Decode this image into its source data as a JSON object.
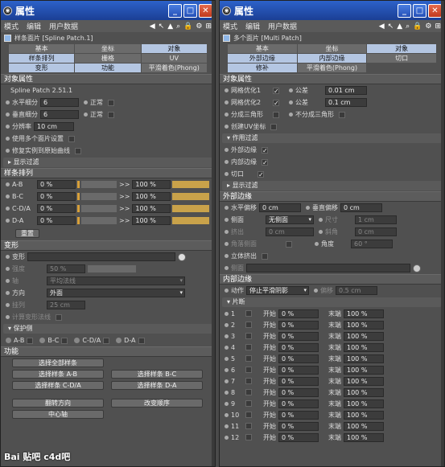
{
  "left": {
    "title": "属性",
    "menu": [
      "模式",
      "编辑",
      "用户数据"
    ],
    "object_name": "样条面片 [Spline Patch.1]",
    "tabs": [
      [
        "基本",
        "坐标",
        "对象"
      ],
      [
        "样条排列",
        "栅格",
        "UV"
      ],
      [
        "变形",
        "功能",
        "平滑着色(Phong)"
      ]
    ],
    "active_tab": "对象",
    "obj_props": {
      "header": "对象属性",
      "version": "Spline Patch 2.51.1",
      "h_sub_label": "水平细分",
      "h_sub_value": "6",
      "h_normal_label": "正常",
      "v_sub_label": "垂直细分",
      "v_sub_value": "6",
      "v_normal_label": "正常",
      "res_label": "分辨率",
      "res_value": "10 cm",
      "multi_patch": "使用多个面片设置",
      "fix_inst": "修复实例到原始曲线",
      "show_filter": "显示过滤"
    },
    "spline_layout": {
      "header": "样条排列",
      "rows": [
        {
          "label": "A-B",
          "start": "0 %",
          "end": "100 %"
        },
        {
          "label": "B-C",
          "start": "0 %",
          "end": "100 %"
        },
        {
          "label": "C-D/A",
          "start": "0 %",
          "end": "100 %"
        },
        {
          "label": "D-A",
          "start": "0 %",
          "end": "100 %"
        }
      ],
      "reset": "重置"
    },
    "deform": {
      "header": "变形",
      "deform_label": "变形",
      "strength_label": "强度",
      "strength_value": "50 %",
      "axis_label": "轴",
      "axis_value": "平均法线",
      "dir_label": "方向",
      "dir_value": "外面",
      "offset_label": "挂列",
      "offset_value": "25 cm",
      "calc_label": "计算变形法线",
      "protect": "保护侧",
      "protect_items": [
        "A-B",
        "B-C",
        "C-D/A",
        "D-A"
      ]
    },
    "funcs": {
      "header": "功能",
      "select_all": "选择全部样条",
      "sel_ab": "选择样条 A-B",
      "sel_bc": "选择样条 B-C",
      "sel_cda": "选择样条 C-D/A",
      "sel_da": "选择样条 D-A",
      "flip": "翻转方向",
      "reorder": "改变顺序",
      "center": "中心轴"
    },
    "watermark": "Bai 贴吧 c4d吧"
  },
  "right": {
    "title": "属性",
    "menu": [
      "模式",
      "编辑",
      "用户数据"
    ],
    "object_name": "多个面片 [Multi Patch]",
    "tabs": [
      [
        "基本",
        "坐标",
        "对象"
      ],
      [
        "外部边缘",
        "内部边缘",
        "切口"
      ],
      [
        "修补",
        "平滑着色(Phong)",
        ""
      ]
    ],
    "active_tab": "对象",
    "obj_props": {
      "header": "对象属性",
      "mesh_opt1": "网格优化1",
      "tol1_label": "公差",
      "tol1_value": "0.01 cm",
      "mesh_opt2": "网格优化2",
      "tol2_label": "公差",
      "tol2_value": "0.1 cm",
      "split_tri": "分成三角形",
      "no_split_tri": "不分成三角形",
      "create_uv": "创建UV坐标",
      "filter_header": "作用过滤",
      "outer": "外部边缘",
      "inner": "内部边缘",
      "cut": "切口",
      "show_filter": "显示过滤"
    },
    "outer_edge": {
      "header": "外部边缘",
      "h_offset_label": "水平偏移",
      "h_offset_value": "0 cm",
      "v_offset_label": "垂直偏移",
      "v_offset_value": "0 cm",
      "side_label": "侧面",
      "side_value": "无侧面",
      "size_label": "尺寸",
      "size_value": "1 cm",
      "extrude_label": "挤出",
      "extrude_value": "0 cm",
      "bevel_label": "斜角",
      "bevel_value": "0 cm",
      "corner_label": "角落侧面",
      "angle_label": "角度",
      "angle_value": "60 °",
      "solid_label": "立体挤出",
      "sides_label": "侧面"
    },
    "inner_edge": {
      "header": "内部边缘",
      "action_label": "动作",
      "action_value": "停止平滑阴影",
      "offset_label": "偏移",
      "offset_value": "0.5 cm"
    },
    "segments": {
      "header": "片断",
      "start_label": "开始",
      "end_label": "末端",
      "rows": [
        {
          "n": "1",
          "start": "0 %",
          "end": "100 %"
        },
        {
          "n": "2",
          "start": "0 %",
          "end": "100 %"
        },
        {
          "n": "3",
          "start": "0 %",
          "end": "100 %"
        },
        {
          "n": "4",
          "start": "0 %",
          "end": "100 %"
        },
        {
          "n": "5",
          "start": "0 %",
          "end": "100 %"
        },
        {
          "n": "6",
          "start": "0 %",
          "end": "100 %"
        },
        {
          "n": "7",
          "start": "0 %",
          "end": "100 %"
        },
        {
          "n": "8",
          "start": "0 %",
          "end": "100 %"
        },
        {
          "n": "9",
          "start": "0 %",
          "end": "100 %"
        },
        {
          "n": "10",
          "start": "0 %",
          "end": "100 %"
        },
        {
          "n": "11",
          "start": "0 %",
          "end": "100 %"
        },
        {
          "n": "12",
          "start": "0 %",
          "end": "100 %"
        }
      ]
    }
  }
}
